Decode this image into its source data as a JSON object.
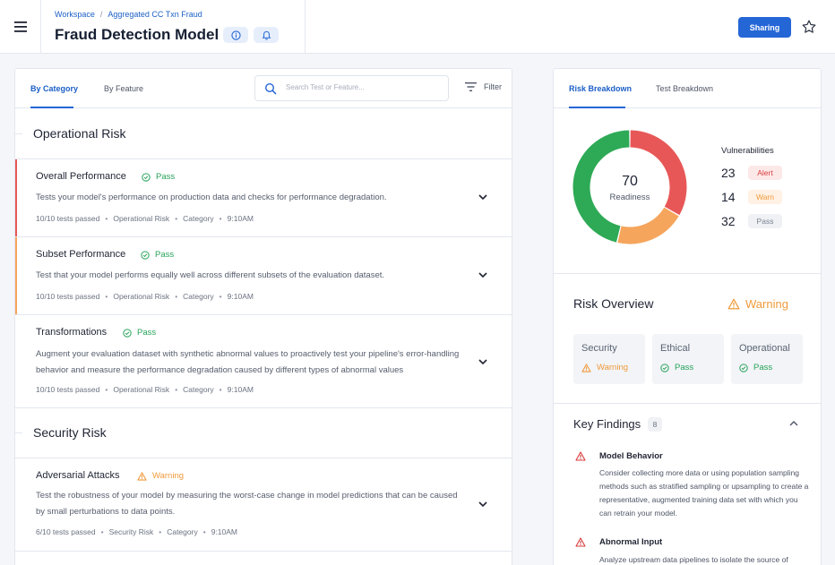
{
  "header": {
    "breadcrumb": [
      "Workspace",
      "Aggregated CC Txn Fraud"
    ],
    "title": "Fraud Detection Model",
    "sharing_label": "Sharing"
  },
  "left": {
    "tabs": [
      "By Category",
      "By Feature"
    ],
    "search_placeholder": "Search Test or Feature...",
    "filter_label": "Filter",
    "sections": [
      {
        "title": "Operational Risk",
        "tests": [
          {
            "title": "Overall Performance",
            "status": "Pass",
            "description": "Tests your model's performance on production data and checks for performance degradation.",
            "meta": [
              "10/10 tests passed",
              "Operational Risk",
              "Category",
              "9:10AM"
            ]
          },
          {
            "title": "Subset Performance",
            "status": "Pass",
            "description": "Test that your model performs equally well across different subsets of the evaluation dataset.",
            "meta": [
              "10/10 tests passed",
              "Operational Risk",
              "Category",
              "9:10AM"
            ]
          },
          {
            "title": "Transformations",
            "status": "Pass",
            "description": "Augment your evaluation dataset with synthetic abnormal values to proactively test your pipeline's error-handling behavior and measure the performance degradation caused by different types of abnormal values",
            "meta": [
              "10/10 tests passed",
              "Operational Risk",
              "Category",
              "9:10AM"
            ]
          }
        ]
      },
      {
        "title": "Security Risk",
        "tests": [
          {
            "title": "Adversarial Attacks",
            "status": "Warning",
            "description": "Test the robustness of your model by measuring the worst-case change in model predictions that can be caused by small perturbations to data points.",
            "meta": [
              "6/10 tests passed",
              "Security Risk",
              "Category",
              "9:10AM"
            ]
          }
        ]
      }
    ]
  },
  "right": {
    "tabs": [
      "Risk Breakdown",
      "Test Breakdown"
    ],
    "readiness": {
      "value": "70",
      "label": "Readiness"
    },
    "vulnerabilities": {
      "title": "Vulnerabilities",
      "items": [
        {
          "count": 23,
          "label": "Alert",
          "color": "#e85757"
        },
        {
          "count": 14,
          "label": "Warn",
          "color": "#f5a55c"
        },
        {
          "count": 32,
          "label": "Pass",
          "color": "#2eaa56"
        }
      ]
    },
    "risk_overview": {
      "title": "Risk Overview",
      "status": "Warning",
      "cards": [
        {
          "name": "Security",
          "status": "Warning"
        },
        {
          "name": "Ethical",
          "status": "Pass"
        },
        {
          "name": "Operational",
          "status": "Pass"
        }
      ]
    },
    "key_findings": {
      "title": "Key Findings",
      "count": "8",
      "items": [
        {
          "title": "Model Behavior",
          "body": "Consider collecting more data or using population sampling methods such as stratified sampling or upsampling to create a representative, augmented training data set with which you can retrain your model."
        },
        {
          "title": "Abnormal Input",
          "body": "Analyze upstream data pipelines to isolate the source of"
        }
      ]
    }
  },
  "colors": {
    "accent": "#2466d6",
    "pass": "#27a35a",
    "warning": "#f09a3b",
    "alert": "#d83b3b"
  }
}
